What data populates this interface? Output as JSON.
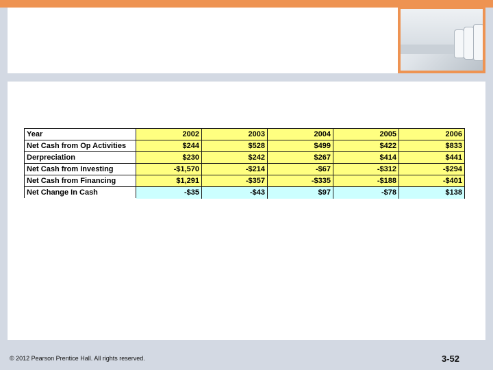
{
  "table": {
    "header": {
      "label": "Year",
      "values": [
        "2002",
        "2003",
        "2004",
        "2005",
        "2006"
      ]
    },
    "rows": [
      {
        "label": "Net Cash from Op Activities",
        "values": [
          "$244",
          "$528",
          "$499",
          "$422",
          "$833"
        ]
      },
      {
        "label": "Derpreciation",
        "values": [
          "$230",
          "$242",
          "$267",
          "$414",
          "$441"
        ]
      },
      {
        "label": "Net Cash from Investing",
        "values": [
          "-$1,570",
          "-$214",
          "-$67",
          "-$312",
          "-$294"
        ]
      },
      {
        "label": "Net Cash from Financing",
        "values": [
          "$1,291",
          "-$357",
          "-$335",
          "-$188",
          "-$401"
        ]
      },
      {
        "label": "Net Change In Cash",
        "values": [
          "-$35",
          "-$43",
          "$97",
          "-$78",
          "$138"
        ]
      }
    ]
  },
  "footer": {
    "copyright": "© 2012 Pearson Prentice Hall. All rights reserved.",
    "slide_number": "3-52"
  },
  "colors": {
    "accent": "#ee9352",
    "highlight": "#ffff80",
    "total_row": "#ccffff",
    "frame": "#d3d9e3"
  }
}
